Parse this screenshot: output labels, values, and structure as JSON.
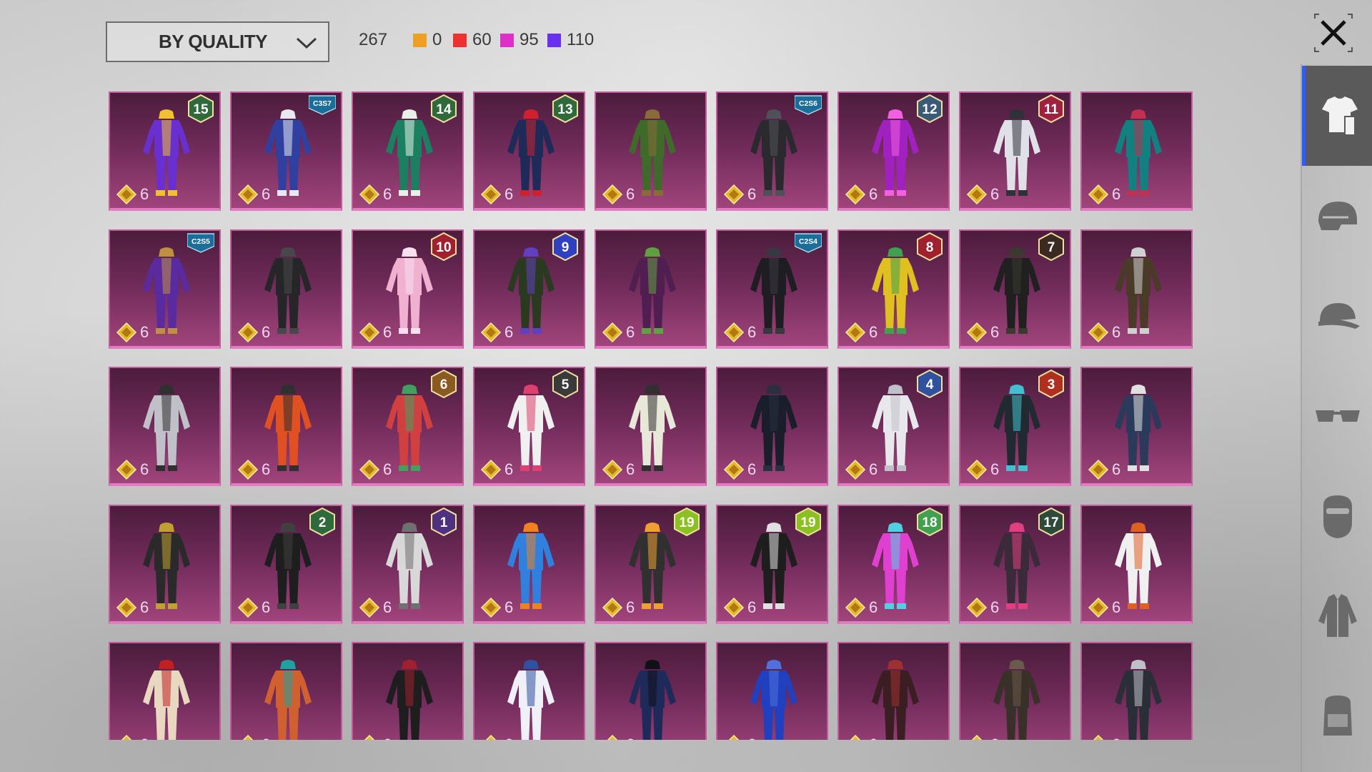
{
  "sort": {
    "label": "BY QUALITY"
  },
  "stats": {
    "total": "267",
    "qualities": [
      {
        "color": "#f0a020",
        "count": "0"
      },
      {
        "color": "#ee3030",
        "count": "60"
      },
      {
        "color": "#e02ec8",
        "count": "95"
      },
      {
        "color": "#6a30f0",
        "count": "110"
      }
    ]
  },
  "sidebar": {
    "items": [
      {
        "icon": "outfit-icon",
        "active": true
      },
      {
        "icon": "helmet-icon",
        "active": false
      },
      {
        "icon": "cap-icon",
        "active": false
      },
      {
        "icon": "glasses-icon",
        "active": false
      },
      {
        "icon": "mask-icon",
        "active": false
      },
      {
        "icon": "jacket-icon",
        "active": false
      },
      {
        "icon": "backpack-icon",
        "active": false
      }
    ]
  },
  "grid": {
    "price": "6",
    "items": [
      {
        "badge": "15",
        "badge_type": "level",
        "badge_color": "#2e6a3a",
        "colors": [
          "#6a2fd0",
          "#f0c030"
        ]
      },
      {
        "badge": "C3S7",
        "badge_type": "season",
        "badge_color": "#1b6d9a",
        "colors": [
          "#3040a0",
          "#e8e8f0"
        ]
      },
      {
        "badge": "14",
        "badge_type": "level",
        "badge_color": "#2e6a3a",
        "colors": [
          "#1a8060",
          "#e8f0e8"
        ]
      },
      {
        "badge": "13",
        "badge_type": "level",
        "badge_color": "#2e6a3a",
        "colors": [
          "#1e2a58",
          "#d02030"
        ]
      },
      {
        "badge": "",
        "badge_type": "",
        "badge_color": "",
        "colors": [
          "#3f6a2a",
          "#8a6a3a"
        ]
      },
      {
        "badge": "C2S6",
        "badge_type": "season",
        "badge_color": "#1b6d9a",
        "colors": [
          "#2a2a2e",
          "#505058"
        ]
      },
      {
        "badge": "12",
        "badge_type": "level",
        "badge_color": "#3a5a7a",
        "colors": [
          "#a020c0",
          "#f060e0"
        ]
      },
      {
        "badge": "11",
        "badge_type": "level",
        "badge_color": "#a02040",
        "colors": [
          "#e0e0e8",
          "#303038"
        ]
      },
      {
        "badge": "",
        "badge_type": "",
        "badge_color": "",
        "colors": [
          "#108080",
          "#c03050"
        ]
      },
      {
        "badge": "C2S5",
        "badge_type": "season",
        "badge_color": "#1b6d9a",
        "colors": [
          "#5a2aa0",
          "#c09040"
        ]
      },
      {
        "badge": "",
        "badge_type": "",
        "badge_color": "",
        "colors": [
          "#262628",
          "#48484c"
        ]
      },
      {
        "badge": "10",
        "badge_type": "level",
        "badge_color": "#a02030",
        "colors": [
          "#f0b0d0",
          "#f8e0ee"
        ]
      },
      {
        "badge": "9",
        "badge_type": "level",
        "badge_color": "#3040c0",
        "colors": [
          "#2a3a20",
          "#6040c0"
        ]
      },
      {
        "badge": "",
        "badge_type": "",
        "badge_color": "",
        "colors": [
          "#501e50",
          "#60a040"
        ]
      },
      {
        "badge": "C2S4",
        "badge_type": "season",
        "badge_color": "#1b6d9a",
        "colors": [
          "#1e1e22",
          "#383840"
        ]
      },
      {
        "badge": "8",
        "badge_type": "level",
        "badge_color": "#a02030",
        "colors": [
          "#e0c020",
          "#40a050"
        ]
      },
      {
        "badge": "7",
        "badge_type": "level",
        "badge_color": "#3a2a20",
        "colors": [
          "#202020",
          "#3a3a30"
        ]
      },
      {
        "badge": "",
        "badge_type": "",
        "badge_color": "",
        "colors": [
          "#4a3a28",
          "#d0d0d0"
        ]
      },
      {
        "badge": "",
        "badge_type": "",
        "badge_color": "",
        "colors": [
          "#c0c0c8",
          "#303030"
        ]
      },
      {
        "badge": "",
        "badge_type": "",
        "badge_color": "",
        "colors": [
          "#e05020",
          "#303030"
        ]
      },
      {
        "badge": "6",
        "badge_type": "level",
        "badge_color": "#8a5a20",
        "colors": [
          "#d04040",
          "#40a060"
        ]
      },
      {
        "badge": "5",
        "badge_type": "level",
        "badge_color": "#3a3a3a",
        "colors": [
          "#f0f0f0",
          "#e04070"
        ]
      },
      {
        "badge": "",
        "badge_type": "",
        "badge_color": "",
        "colors": [
          "#e8e8d8",
          "#303030"
        ]
      },
      {
        "badge": "",
        "badge_type": "",
        "badge_color": "",
        "colors": [
          "#1a1e2a",
          "#2a3040"
        ]
      },
      {
        "badge": "4",
        "badge_type": "level",
        "badge_color": "#3050a0",
        "colors": [
          "#e8e8ec",
          "#c0c0c8"
        ]
      },
      {
        "badge": "3",
        "badge_type": "level",
        "badge_color": "#b03020",
        "colors": [
          "#202a30",
          "#40c0d0"
        ]
      },
      {
        "badge": "",
        "badge_type": "",
        "badge_color": "",
        "colors": [
          "#2a3a5a",
          "#e0e0e0"
        ]
      },
      {
        "badge": "",
        "badge_type": "",
        "badge_color": "",
        "colors": [
          "#2a2a2a",
          "#c0a030"
        ]
      },
      {
        "badge": "2",
        "badge_type": "level",
        "badge_color": "#2e6a3a",
        "colors": [
          "#1e1e1e",
          "#404040"
        ]
      },
      {
        "badge": "1",
        "badge_type": "level",
        "badge_color": "#503080",
        "colors": [
          "#d8d8d8",
          "#707070"
        ]
      },
      {
        "badge": "",
        "badge_type": "",
        "badge_color": "",
        "colors": [
          "#3080e0",
          "#f08020"
        ]
      },
      {
        "badge": "19",
        "badge_type": "level",
        "badge_color": "#8ac020",
        "colors": [
          "#303030",
          "#f0a030"
        ]
      },
      {
        "badge": "19",
        "badge_type": "level",
        "badge_color": "#8ac020",
        "colors": [
          "#1e1e1e",
          "#e0e0e0"
        ]
      },
      {
        "badge": "18",
        "badge_type": "level",
        "badge_color": "#40a050",
        "colors": [
          "#e040d0",
          "#50d0e0"
        ]
      },
      {
        "badge": "17",
        "badge_type": "level",
        "badge_color": "#2e4a3a",
        "colors": [
          "#3a2a3a",
          "#e04080"
        ]
      },
      {
        "badge": "",
        "badge_type": "",
        "badge_color": "",
        "colors": [
          "#f0f0f0",
          "#e06020"
        ]
      },
      {
        "badge": "",
        "badge_type": "",
        "badge_color": "",
        "colors": [
          "#e8d8c0",
          "#c02020"
        ]
      },
      {
        "badge": "",
        "badge_type": "",
        "badge_color": "",
        "colors": [
          "#d06030",
          "#20a0a0"
        ]
      },
      {
        "badge": "",
        "badge_type": "",
        "badge_color": "",
        "colors": [
          "#1e1e1e",
          "#a02030"
        ]
      },
      {
        "badge": "",
        "badge_type": "",
        "badge_color": "",
        "colors": [
          "#f0f0f8",
          "#3050a0"
        ]
      },
      {
        "badge": "",
        "badge_type": "",
        "badge_color": "",
        "colors": [
          "#1e2a5a",
          "#101018"
        ]
      },
      {
        "badge": "",
        "badge_type": "",
        "badge_color": "",
        "colors": [
          "#2040c0",
          "#5070e0"
        ]
      },
      {
        "badge": "",
        "badge_type": "",
        "badge_color": "",
        "colors": [
          "#3a1e22",
          "#a03030"
        ]
      },
      {
        "badge": "",
        "badge_type": "",
        "badge_color": "",
        "colors": [
          "#3a302a",
          "#6a5a4a"
        ]
      },
      {
        "badge": "",
        "badge_type": "",
        "badge_color": "",
        "colors": [
          "#2a2e36",
          "#c0c0c8"
        ]
      }
    ]
  }
}
